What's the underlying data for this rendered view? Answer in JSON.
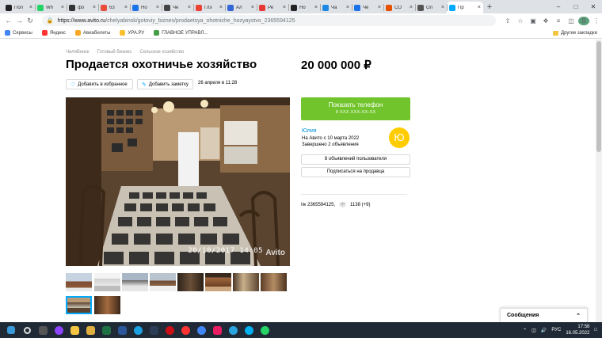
{
  "browser": {
    "tabs": [
      {
        "title": "Пол",
        "color": "#222"
      },
      {
        "title": "Wh",
        "color": "#25d366"
      },
      {
        "title": "фо",
        "color": "#333"
      },
      {
        "title": "63",
        "color": "#e74c3c"
      },
      {
        "title": "Но",
        "color": "#1a73e8"
      },
      {
        "title": "Че",
        "color": "#444"
      },
      {
        "title": "Глэ",
        "color": "#ea4335"
      },
      {
        "title": "Ал",
        "color": "#3367d6"
      },
      {
        "title": "Ре",
        "color": "#e53935"
      },
      {
        "title": "Но",
        "color": "#222"
      },
      {
        "title": "Ча",
        "color": "#1e88e5"
      },
      {
        "title": "Че",
        "color": "#1a73e8"
      },
      {
        "title": "СО",
        "color": "#e65100"
      },
      {
        "title": "Ол",
        "color": "#555"
      },
      {
        "title": "Пр",
        "color": "#00aaff"
      }
    ],
    "active_tab_index": 14,
    "new_tab_label": "+",
    "url_host": "https://www.avito.ru",
    "url_path": "/chelyabinsk/gotoviy_biznes/prodaetsya_ohotniche_hozyaystvo_2365594125",
    "bookmarks": [
      {
        "label": "Сервисы",
        "color": "#4285f4"
      },
      {
        "label": "Яндекс",
        "color": "#ff3333"
      },
      {
        "label": "Авиабилеты",
        "color": "#f9a825"
      },
      {
        "label": "УРА.РУ",
        "color": "#fbc02d"
      },
      {
        "label": "ГЛАВНОЕ УПРАВЛ...",
        "color": "#43a047"
      }
    ],
    "other_bookmarks": "Другие закладки",
    "profile_letter": "В"
  },
  "listing": {
    "breadcrumbs": [
      "Челябинск",
      "Готовый бизнес",
      "Сельское хозяйство"
    ],
    "title": "Продается охотничье хозяйство",
    "price": "20 000 000 ₽",
    "add_favorite": "Добавить в избранное",
    "add_note": "Добавить заметку",
    "date": "26 апреля в 11:28",
    "photo_stamp": "20/10/2017 14:05",
    "watermark": "Avito",
    "ad_number": "№ 2365594125,",
    "views": "1138 (+9)"
  },
  "seller": {
    "phone_button": "Показать телефон",
    "phone_mask": "8 XXX XXX-XX-XX",
    "name": "Юлия",
    "since": "На Авито с 10 марта 2022",
    "completed": "Завершено 2 объявления",
    "avatar_letter": "Ю",
    "ads_button": "8 объявлений пользователя",
    "subscribe_button": "Подписаться на продавца"
  },
  "messages": {
    "label": "Сообщения"
  },
  "taskbar": {
    "lang": "РУС",
    "time": "17:58",
    "date": "16.05.2022"
  }
}
